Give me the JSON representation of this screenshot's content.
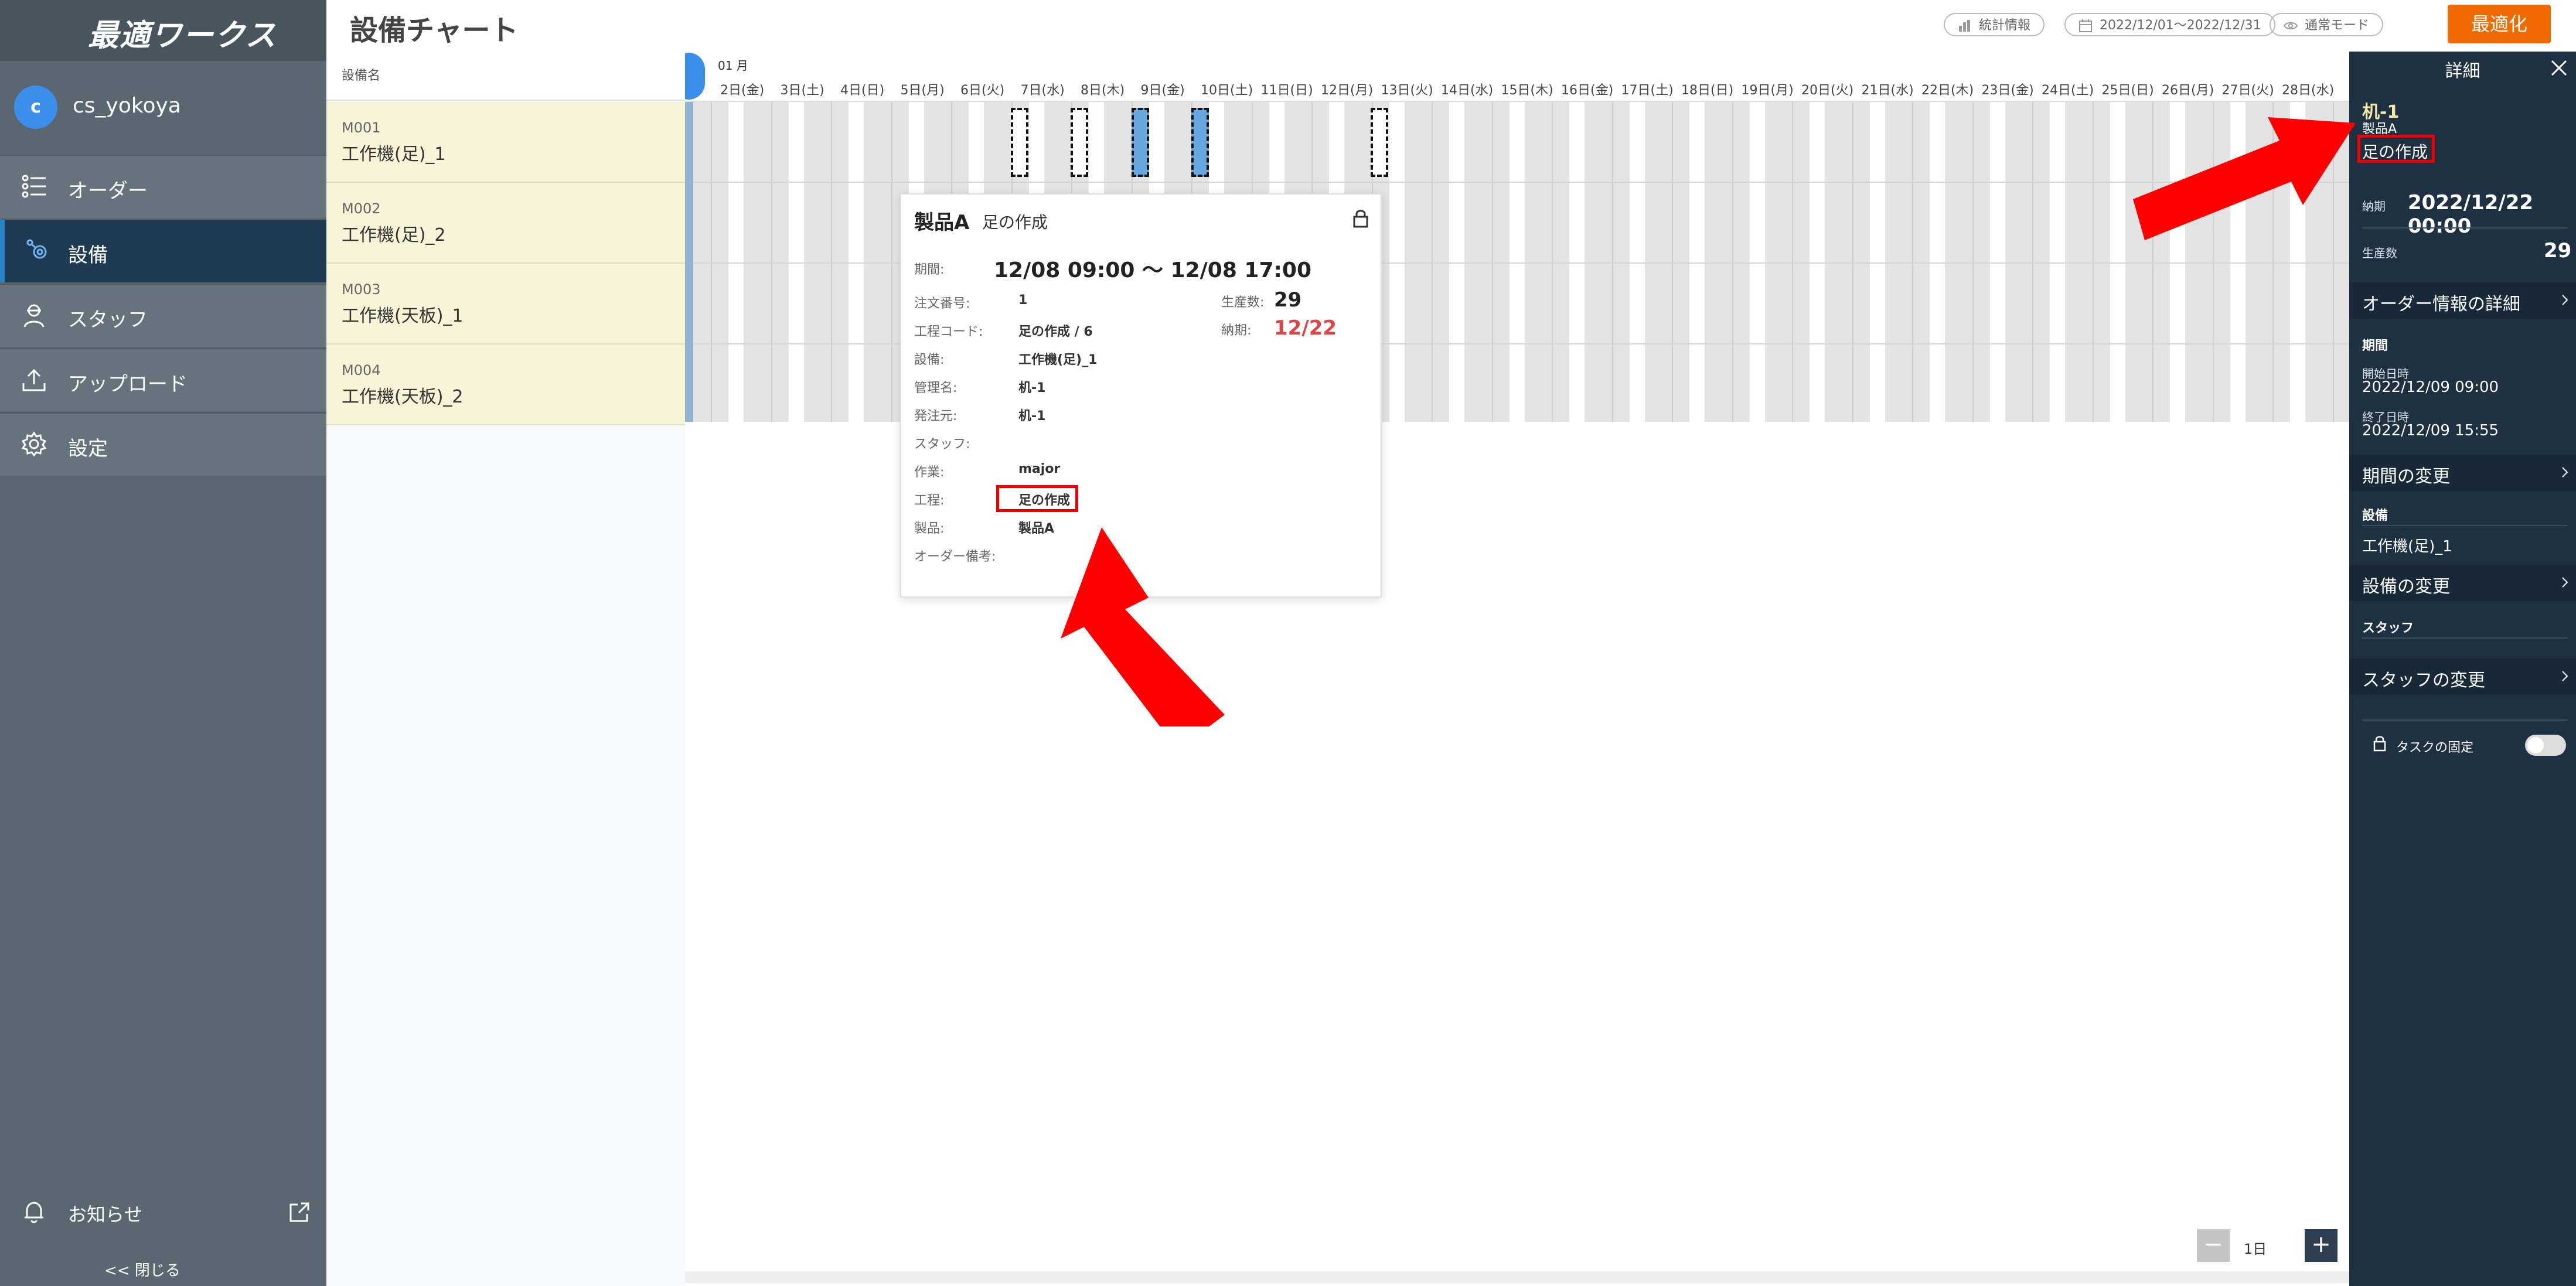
{
  "app": {
    "logo": "最適ワークス",
    "page_title": "設備チャート"
  },
  "user": {
    "initial": "c",
    "name": "cs_yokoya"
  },
  "nav": [
    {
      "label": "オーダー",
      "icon": "list-icon"
    },
    {
      "label": "設備",
      "icon": "gear-network-icon",
      "active": true
    },
    {
      "label": "スタッフ",
      "icon": "staff-icon"
    },
    {
      "label": "アップロード",
      "icon": "upload-icon"
    },
    {
      "label": "設定",
      "icon": "settings-icon"
    }
  ],
  "sidebar_footer": {
    "notice_label": "お知らせ",
    "collapse_label": "<<  閉じる"
  },
  "header": {
    "stats_label": "統計情報",
    "date_range_label": "2022/12/01〜2022/12/31",
    "mode_label": "通常モード",
    "optimize_label": "最適化"
  },
  "equipment": {
    "header_label": "設備名",
    "rows": [
      {
        "code": "M001",
        "name": "工作機(足)_1"
      },
      {
        "code": "M002",
        "name": "工作機(足)_2"
      },
      {
        "code": "M003",
        "name": "工作機(天板)_1"
      },
      {
        "code": "M004",
        "name": "工作機(天板)_2"
      }
    ]
  },
  "chart": {
    "month_label": "01 月",
    "dates": [
      "2日(金)",
      "3日(土)",
      "4日(日)",
      "5日(月)",
      "6日(火)",
      "7日(水)",
      "8日(木)",
      "9日(金)",
      "10日(土)",
      "11日(日)",
      "12日(月)",
      "13日(火)",
      "14日(水)",
      "15日(木)",
      "16日(金)",
      "17日(土)",
      "18日(日)",
      "19日(月)",
      "20日(火)",
      "21日(水)",
      "22日(木)",
      "23日(金)",
      "24日(土)",
      "25日(日)",
      "26日(月)",
      "27日(火)",
      "28日(水)"
    ],
    "zoom_label": "1日",
    "zoom_minus": "−",
    "zoom_plus": "+"
  },
  "popup": {
    "product": "製品A",
    "process": "足の作成",
    "period_label": "期間:",
    "period_value": "12/08 09:00 〜 12/08 17:00",
    "fields": [
      {
        "label": "注文番号:",
        "value": "1"
      },
      {
        "label": "工程コード:",
        "value": "足の作成 / 6"
      },
      {
        "label": "設備:",
        "value": "工作機(足)_1"
      },
      {
        "label": "管理名:",
        "value": "机-1"
      },
      {
        "label": "発注元:",
        "value": "机-1"
      },
      {
        "label": "スタッフ:",
        "value": ""
      },
      {
        "label": "作業:",
        "value": "major"
      },
      {
        "label": "工程:",
        "value": "足の作成"
      },
      {
        "label": "製品:",
        "value": "製品A"
      },
      {
        "label": "オーダー備考:",
        "value": ""
      }
    ],
    "quantity_label": "生産数:",
    "quantity_value": "29",
    "due_label": "納期:",
    "due_value": "12/22"
  },
  "detail": {
    "title": "詳細",
    "admin_name": "机-1",
    "product": "製品A",
    "process": "足の作成",
    "due_label": "納期",
    "due_value": "2022/12/22 00:00",
    "quantity_label": "生産数",
    "quantity_value": "29",
    "order_detail_label": "オーダー情報の詳細",
    "period_heading": "期間",
    "start_label": "開始日時",
    "start_value": "2022/12/09 09:00",
    "end_label": "終了日時",
    "end_value": "2022/12/09 15:55",
    "change_period_label": "期間の変更",
    "equipment_heading": "設備",
    "equipment_value": "工作機(足)_1",
    "change_equipment_label": "設備の変更",
    "staff_heading": "スタッフ",
    "change_staff_label": "スタッフの変更",
    "task_lock_label": "タスクの固定",
    "task_lock_on": false
  },
  "colors": {
    "sidebar": "#5a6770",
    "active_nav": "#1f3b54",
    "accent": "#f06a00",
    "detail_panel": "#1e3142",
    "equipment_row": "#f7f3d6",
    "highlight_red": "#e00000"
  }
}
